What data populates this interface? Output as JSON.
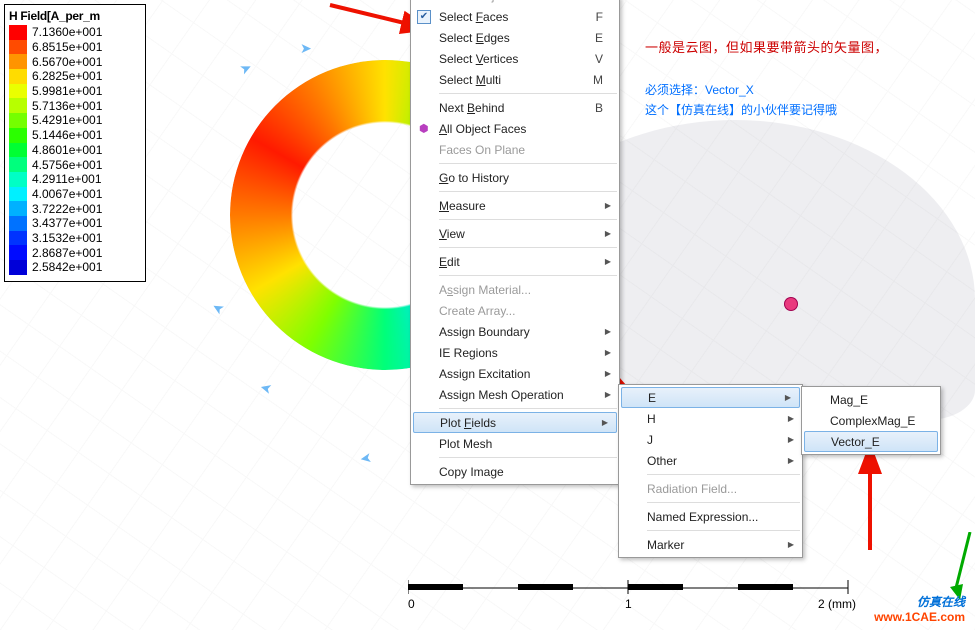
{
  "legend": {
    "title": "H Field[A_per_m",
    "entries": [
      {
        "color": "#ff0000",
        "value": "7.1360e+001"
      },
      {
        "color": "#ff4b00",
        "value": "6.8515e+001"
      },
      {
        "color": "#ff9400",
        "value": "6.5670e+001"
      },
      {
        "color": "#ffdc00",
        "value": "6.2825e+001"
      },
      {
        "color": "#eaff00",
        "value": "5.9981e+001"
      },
      {
        "color": "#b7ff00",
        "value": "5.7136e+001"
      },
      {
        "color": "#74ff00",
        "value": "5.4291e+001"
      },
      {
        "color": "#2bff00",
        "value": "5.1446e+001"
      },
      {
        "color": "#00ff33",
        "value": "4.8601e+001"
      },
      {
        "color": "#00ff7d",
        "value": "4.5756e+001"
      },
      {
        "color": "#00ffc5",
        "value": "4.2911e+001"
      },
      {
        "color": "#00f0ff",
        "value": "4.0067e+001"
      },
      {
        "color": "#00b1ff",
        "value": "3.7222e+001"
      },
      {
        "color": "#0072ff",
        "value": "3.4377e+001"
      },
      {
        "color": "#0033ff",
        "value": "3.1532e+001"
      },
      {
        "color": "#000bff",
        "value": "2.8687e+001"
      },
      {
        "color": "#0000d8",
        "value": "2.5842e+001"
      }
    ]
  },
  "menu1": {
    "items": [
      {
        "label": "Select Objects",
        "shortcut": "O",
        "disabled": true,
        "cutoff": true
      },
      {
        "label": "Select Faces",
        "shortcut": "F",
        "checked": true,
        "u": 7
      },
      {
        "label": "Select Edges",
        "shortcut": "E",
        "u": 7
      },
      {
        "label": "Select Vertices",
        "shortcut": "V",
        "u": 7
      },
      {
        "label": "Select Multi",
        "shortcut": "M",
        "u": 7
      },
      {
        "sep": true
      },
      {
        "label": "Next Behind",
        "shortcut": "B",
        "u": 5
      },
      {
        "label": "All Object Faces",
        "icon": "cube",
        "u": 0
      },
      {
        "label": "Faces On Plane",
        "disabled": true
      },
      {
        "sep": true
      },
      {
        "label": "Go to History",
        "u": 0
      },
      {
        "sep": true
      },
      {
        "label": "Measure",
        "arrow": true,
        "u": 0
      },
      {
        "sep": true
      },
      {
        "label": "View",
        "arrow": true,
        "u": 0
      },
      {
        "sep": true
      },
      {
        "label": "Edit",
        "arrow": true,
        "u": 0
      },
      {
        "sep": true
      },
      {
        "label": "Assign Material...",
        "disabled": true,
        "u": 1
      },
      {
        "label": "Create Array...",
        "disabled": true
      },
      {
        "label": "Assign Boundary",
        "arrow": true
      },
      {
        "label": "IE Regions",
        "arrow": true
      },
      {
        "label": "Assign Excitation",
        "arrow": true
      },
      {
        "label": "Assign Mesh Operation",
        "arrow": true
      },
      {
        "sep": true
      },
      {
        "label": "Plot Fields",
        "arrow": true,
        "highlight": true,
        "u": 5
      },
      {
        "label": "Plot Mesh"
      },
      {
        "sep": true
      },
      {
        "label": "Copy Image"
      }
    ]
  },
  "menu2": {
    "items": [
      {
        "label": "E",
        "arrow": true,
        "highlight": true
      },
      {
        "label": "H",
        "arrow": true
      },
      {
        "label": "J",
        "arrow": true
      },
      {
        "label": "Other",
        "arrow": true
      },
      {
        "sep": true
      },
      {
        "label": "Radiation Field...",
        "disabled": true
      },
      {
        "sep": true
      },
      {
        "label": "Named Expression..."
      },
      {
        "sep": true
      },
      {
        "label": "Marker",
        "arrow": true
      }
    ]
  },
  "menu3": {
    "items": [
      {
        "label": "Mag_E"
      },
      {
        "label": "ComplexMag_E"
      },
      {
        "label": "Vector_E",
        "highlight": true
      }
    ]
  },
  "annot": {
    "red": "一般是云图，但如果要带箭头的矢量图，",
    "blue1": "必须选择：Vector_X",
    "blue2": "这个【仿真在线】的小伙伴要记得哦"
  },
  "scale": {
    "ticks": [
      "0",
      "1",
      "2 (mm)"
    ]
  },
  "watermark": {
    "line1": "仿真在线",
    "line2": "www.1CAE.com"
  }
}
